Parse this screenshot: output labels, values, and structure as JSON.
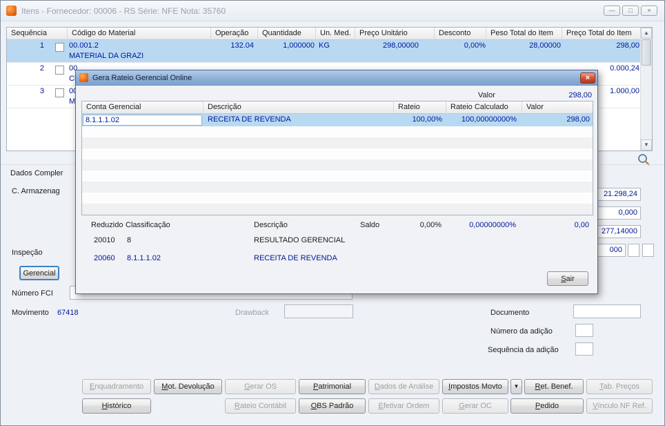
{
  "window": {
    "title": "Itens - Fornecedor: 00006 - RS Série: NFE  Nota: 35760",
    "controls": {
      "minimize": "—",
      "maximize": "□",
      "close": "×"
    }
  },
  "items_grid": {
    "columns": [
      "Sequência",
      "Código do Material",
      "Operação",
      "Quantidade",
      "Un. Med.",
      "Preço Unitário",
      "Desconto",
      "Peso Total do Item",
      "Preço Total do Item"
    ],
    "rows": [
      {
        "seq": "1",
        "codigo": "00.001.2",
        "descricao": "MATERIAL DA GRAZI",
        "operacao": "132.04",
        "quantidade": "1,000000",
        "un_med": "KG",
        "preco_unitario": "298,00000",
        "desconto": "0,00%",
        "peso_total": "28,00000",
        "preco_total": "298,00"
      },
      {
        "seq": "2",
        "codigo": "00",
        "descricao": "Ch",
        "preco_total": "0.000,24"
      },
      {
        "seq": "3",
        "codigo": "00",
        "descricao": "Ma",
        "preco_total": "1.000,00"
      }
    ],
    "scroll_up_icon": "▲",
    "scroll_down_icon": "▼"
  },
  "details_panel": {
    "section_label": "Dados Compler",
    "armazenagem_label": "C. Armazenag",
    "inspecao_label": "Inspeção",
    "gerencial_button": "Gerencial",
    "numero_fci_label": "Número FCI",
    "movimento_label": "Movimento",
    "movimento_value": "67418",
    "drawback_label": "Drawback",
    "documento_label": "Documento",
    "numero_adicao_label": "Número da adição",
    "sequencia_adicao_label": "Sequência da adição",
    "values": [
      "21.298,24",
      "0,000",
      "277,14000",
      "000"
    ]
  },
  "action_buttons": {
    "row1": [
      "Enquadramento",
      "Mot. Devolução",
      "Gerar OS",
      "Patrimonial",
      "Dados de Análise",
      "Impostos Movto",
      "Ret. Benef.",
      "Tab. Preços"
    ],
    "row2": [
      "Histórico",
      "Rateio Contábil",
      "OBS Padrão",
      "Efetivar Ordem",
      "Gerar OC",
      "Pedido",
      "Vínculo NF Ref."
    ],
    "dropdown_icon": "▼"
  },
  "dialog": {
    "title": "Gera Rateio Gerencial Online",
    "close_icon": "×",
    "valor_label": "Valor",
    "valor_value": "298,00",
    "grid": {
      "columns": [
        "Conta Gerencial",
        "Descrição",
        "Rateio",
        "Rateio Calculado",
        "Valor"
      ],
      "row": {
        "conta": "8.1.1.1.02",
        "descricao": "RECEITA DE REVENDA",
        "rateio": "100,00%",
        "rateio_calculado": "100,00000000%",
        "valor": "298,00"
      }
    },
    "summary": {
      "reduzido_label": "Reduzido",
      "classificacao_label": "Classificação",
      "descricao_label": "Descrição",
      "saldo_label": "Saldo",
      "rateio_total": "0,00%",
      "rateio_calculado_total": "0,00000000%",
      "valor_total": "0,00",
      "rows": [
        {
          "reduzido": "20010",
          "classificacao": "8",
          "descricao": "RESULTADO GERENCIAL"
        },
        {
          "reduzido": "20060",
          "classificacao": "8.1.1.1.02",
          "descricao": "RECEITA DE REVENDA"
        }
      ]
    },
    "sair_button": "Sair"
  },
  "colors": {
    "value_text": "#001796",
    "selected_row": "#b9d9f2",
    "dialog_titlebar": "#8caed6",
    "close_button_red": "#cf4f35",
    "app_icon_orange": "#e8650f"
  }
}
